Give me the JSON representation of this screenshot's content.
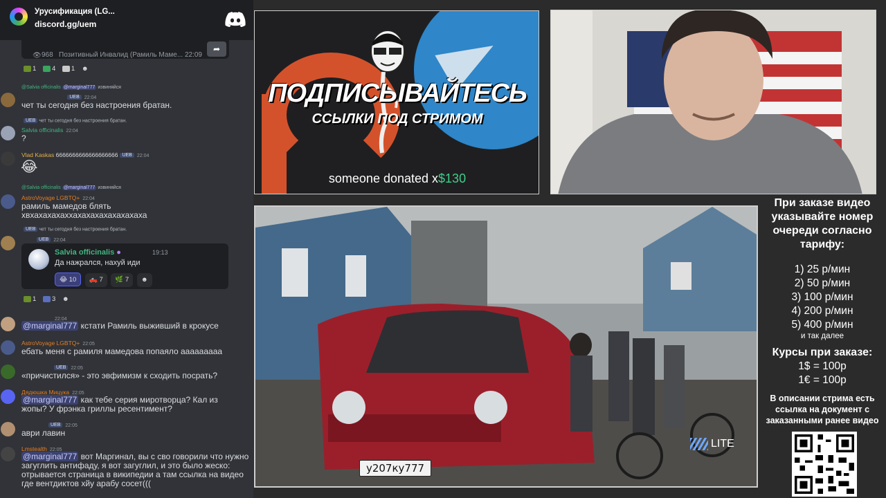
{
  "server": {
    "name": "Урусификация (LG...",
    "link": "discord.gg/uem"
  },
  "embed_top": {
    "views": "968",
    "meta": "Позитивный Инвалид (Рамиль Маме... 22:09"
  },
  "reactions_top": [
    {
      "count": "1"
    },
    {
      "count": "4"
    },
    {
      "count": "1"
    }
  ],
  "messages": [
    {
      "reply_user": "@Salvia officinalis",
      "reply_mention": "@marginal777",
      "reply_text": "извиняйся",
      "badge": "UEB",
      "time": "22:04",
      "text": "чет ты сегодня без настроения братан."
    },
    {
      "reply_text": "чет ты сегодня без настроения братан.",
      "reply_badge": "UEB",
      "user": "Salvia officinalis",
      "time": "22:04",
      "text": "?"
    },
    {
      "user": "Vlad Kaskas",
      "user_tail": "6666666666666666666",
      "badge": "UEB",
      "time": "22:04"
    },
    {
      "reply_user": "@Salvia officinalis",
      "reply_mention": "@marginal777",
      "reply_text": "извиняйся",
      "user": "AstroVoyage LGBTQ+",
      "time": "22:04",
      "text": "рамиль мамедов блять хвхахахахаххахахахахахахахаха"
    },
    {
      "reply_text": "чет ты сегодня без настроения братан.",
      "reply_badge": "UEB",
      "badge": "UEB",
      "time": "22:04"
    },
    {
      "user": "Salvia officinalis",
      "badge": "UEB",
      "time": "22:05",
      "text": "ебать меня с рамиля мамедова попаяло ааааааааа"
    }
  ],
  "quote_card": {
    "name": "Salvia officinalis",
    "time": "19:13",
    "text": "Да нажрался, нахуй иди",
    "reactions": [
      "10",
      "7",
      "7"
    ]
  },
  "reactions_mid": [
    {
      "count": "1"
    },
    {
      "count": "3"
    }
  ],
  "later_messages": [
    {
      "time": "22:04",
      "mention": "@marginal777",
      "text": " кстати Рамиль выживший в крокусе"
    },
    {
      "user": "AstroVoyage LGBTQ+",
      "time": "22:05",
      "text": "ебать меня с рамиля мамедова попаяло ааааааааа"
    },
    {
      "badge": "UEB",
      "time": "22:05",
      "text": "«причистился» - это эвфимизм к сходить посрать?"
    },
    {
      "user": "Дядюшка Мицука",
      "time": "22:05",
      "mention": "@marginal777",
      "text": " как тебе серия миротворца? Кал из жопы? У фрэнка гриллы ресентимент?"
    },
    {
      "badge": "UEB",
      "time": "22:05",
      "text": "аври лавин"
    },
    {
      "user": "Lmstealth",
      "time": "22:05",
      "mention": "@marginal777",
      "text": " вот Маргинал, вы с сво говорили что нужно загуглить антифаду, я вот загуглил, и это было жеско: отрывается страница в википедии а там ссылка на видео где вентдиктов хйу арабу сосет((("
    }
  ],
  "promo": {
    "title": "ПОДПИСЫВАЙТЕСЬ",
    "subtitle": "ССЫЛКИ ПОД СТРИМОМ",
    "donation_text": "someone donated x",
    "donation_amount": "$130"
  },
  "video": {
    "plate": "у207ку777",
    "watermark": "LITE"
  },
  "info": {
    "heading": "При заказе видео указывайте номер очереди согласно тарифу:",
    "tariffs": [
      "1) 25 р/мин",
      "2) 50 р/мин",
      "3) 100 р/мин",
      "4) 200 р/мин",
      "5) 400 р/мин"
    ],
    "etc": "и так далее",
    "courses_title": "Курсы при заказе:",
    "rate_usd": "1$ = 100р",
    "rate_eur": "1€ = 100р",
    "footer": "В описании стрима есть ссылка на документ с заказанными ранее видео"
  },
  "colors": {
    "chat_bg": "#313338",
    "accent_green": "#43b581",
    "mention_bg": "#3c4270",
    "donation_green": "#3fd08a"
  }
}
